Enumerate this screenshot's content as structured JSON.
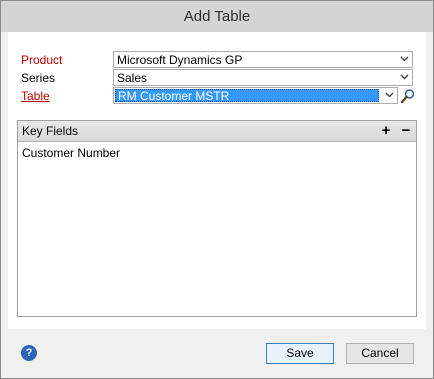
{
  "window": {
    "title": "Add Table"
  },
  "fields": {
    "product": {
      "label": "Product",
      "value": "Microsoft Dynamics GP"
    },
    "series": {
      "label": "Series",
      "value": "Sales"
    },
    "table": {
      "label": "Table",
      "value": "RM Customer MSTR"
    }
  },
  "key_fields": {
    "title": "Key Fields",
    "add_label": "+",
    "remove_label": "−",
    "items": [
      "Customer Number"
    ]
  },
  "footer": {
    "help_label": "?",
    "save_label": "Save",
    "cancel_label": "Cancel"
  },
  "icons": {
    "dropdown": "chevron-down-icon",
    "lookup": "magnifier-icon",
    "help": "help-icon"
  },
  "colors": {
    "required_label": "#c00000",
    "selection": "#3399ff",
    "help": "#2d64b8"
  }
}
